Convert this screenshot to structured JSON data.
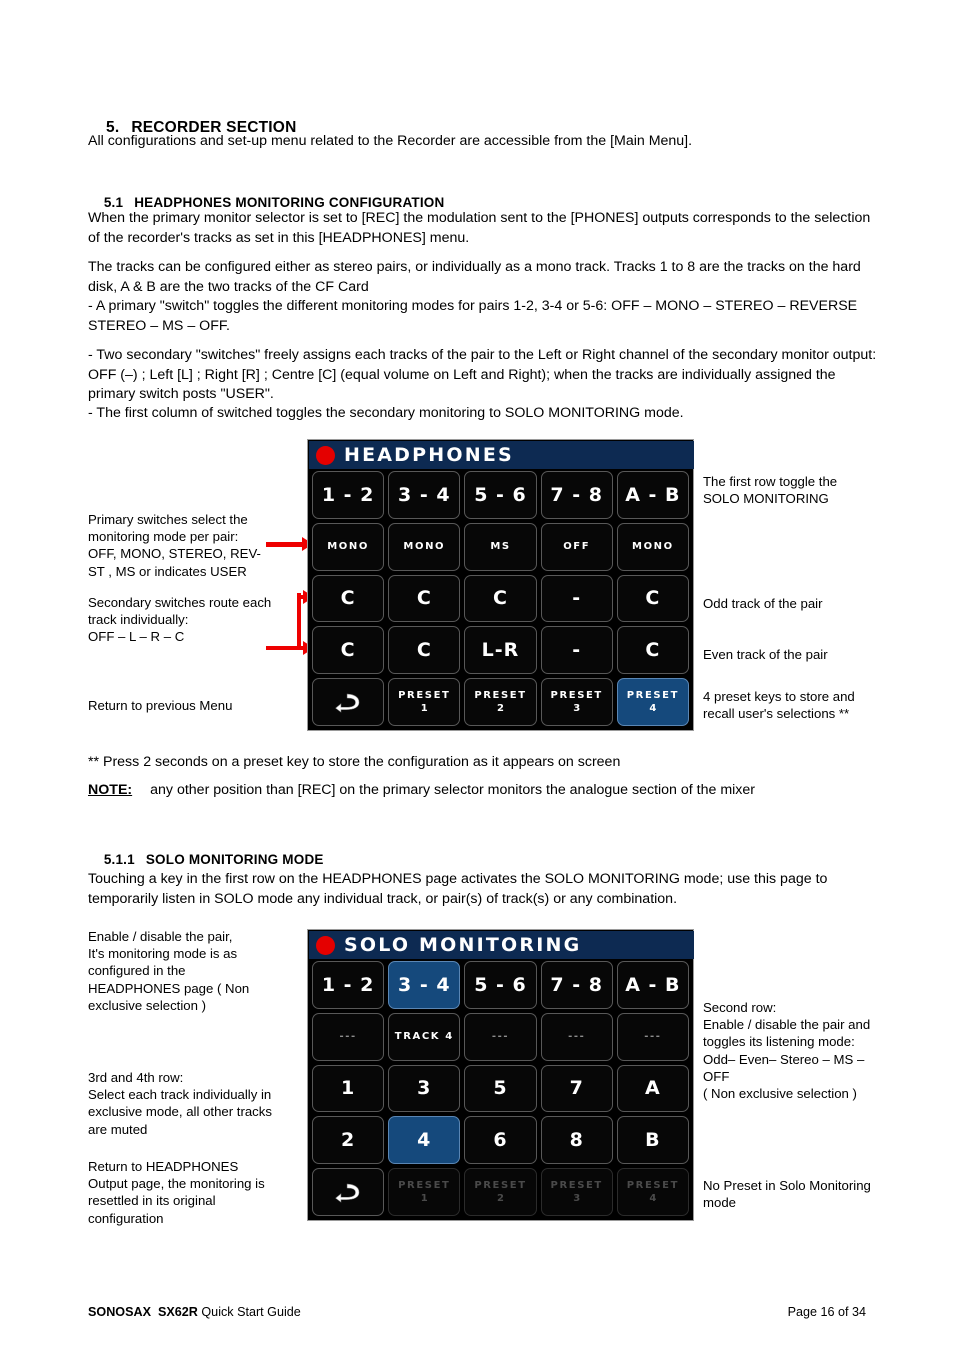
{
  "document": {
    "section_number": "5.",
    "section_title": "RECORDER SECTION",
    "intro": "All configurations and set-up menu related to the Recorder are accessible from the [Main Menu].",
    "sub1_number": "5.1",
    "sub1_title": "HEADPHONES MONITORING CONFIGURATION",
    "p1": "When the primary monitor selector is set to [REC] the modulation sent to the [PHONES] outputs corresponds to the selection of the recorder's tracks as set in this [HEADPHONES] menu.",
    "p2": "The tracks can be configured either as stereo pairs, or individually as a mono track. Tracks 1 to 8 are the tracks on the hard disk, A & B are the two tracks of the CF Card",
    "p3": "- A primary \"switch\" toggles the different monitoring modes for pairs 1-2, 3-4 or 5-6: OFF – MONO – STEREO – REVERSE STEREO – MS – OFF.",
    "p4": "- Two secondary \"switches\" freely assigns each tracks of the pair to the Left or Right channel of the secondary monitor output: OFF (–) ; Left [L] ; Right  [R] ; Centre [C] (equal volume on Left and Right); when the tracks are individually assigned the primary switch posts \"USER\".",
    "p5": "- The first column of switched toggles the secondary monitoring to SOLO MONITORING mode.",
    "p6": "** Press 2 seconds on a preset key to store the configuration as it appears on screen",
    "note_label": "NOTE:",
    "note_text": "any other position than [REC] on the primary selector monitors the analogue section of the mixer",
    "sub2_number": "5.1.1",
    "sub2_title": "SOLO MONITORING MODE",
    "p7": "Touching a key in the first row on the HEADPHONES page activates the SOLO MONITORING mode; use this page to temporarily listen in SOLO mode any individual track, or pair(s) of track(s) or any combination."
  },
  "headphones_screen": {
    "title": "HEADPHONES",
    "rec_indicator": "red-record-dot",
    "rows": [
      {
        "name": "pair-row",
        "keys": [
          {
            "label": "1 - 2",
            "style": "big",
            "state": "normal"
          },
          {
            "label": "3 - 4",
            "style": "big",
            "state": "normal"
          },
          {
            "label": "5 - 6",
            "style": "big",
            "state": "normal"
          },
          {
            "label": "7 - 8",
            "style": "big",
            "state": "normal"
          },
          {
            "label": "A - B",
            "style": "big",
            "state": "normal"
          }
        ]
      },
      {
        "name": "primary-switch-row",
        "keys": [
          {
            "label": "MONO",
            "style": "small",
            "state": "normal"
          },
          {
            "label": "MONO",
            "style": "small",
            "state": "normal"
          },
          {
            "label": "MS",
            "style": "small",
            "state": "normal"
          },
          {
            "label": "OFF",
            "style": "small",
            "state": "normal"
          },
          {
            "label": "MONO",
            "style": "small",
            "state": "normal"
          }
        ]
      },
      {
        "name": "odd-track-row",
        "keys": [
          {
            "label": "C",
            "style": "big",
            "state": "normal"
          },
          {
            "label": "C",
            "style": "big",
            "state": "normal"
          },
          {
            "label": "C",
            "style": "big",
            "state": "normal"
          },
          {
            "label": "-",
            "style": "big",
            "state": "normal"
          },
          {
            "label": "C",
            "style": "big",
            "state": "normal"
          }
        ]
      },
      {
        "name": "even-track-row",
        "keys": [
          {
            "label": "C",
            "style": "big",
            "state": "normal"
          },
          {
            "label": "C",
            "style": "big",
            "state": "normal"
          },
          {
            "label": "L-R",
            "style": "big",
            "state": "normal"
          },
          {
            "label": "-",
            "style": "big",
            "state": "normal"
          },
          {
            "label": "C",
            "style": "big",
            "state": "normal"
          }
        ]
      },
      {
        "name": "preset-row",
        "keys": [
          {
            "label": "",
            "style": "return",
            "state": "normal"
          },
          {
            "label": "PRESET",
            "sub": "1",
            "style": "preset",
            "state": "normal"
          },
          {
            "label": "PRESET",
            "sub": "2",
            "style": "preset",
            "state": "normal"
          },
          {
            "label": "PRESET",
            "sub": "3",
            "style": "preset",
            "state": "normal"
          },
          {
            "label": "PRESET",
            "sub": "4",
            "style": "preset",
            "state": "selected"
          }
        ]
      }
    ]
  },
  "solo_screen": {
    "title": "SOLO MONITORING",
    "rec_indicator": "red-record-dot",
    "rows": [
      {
        "name": "pair-row",
        "keys": [
          {
            "label": "1 - 2",
            "style": "big",
            "state": "normal"
          },
          {
            "label": "3 - 4",
            "style": "big",
            "state": "selected"
          },
          {
            "label": "5 - 6",
            "style": "big",
            "state": "normal"
          },
          {
            "label": "7 - 8",
            "style": "big",
            "state": "normal"
          },
          {
            "label": "A - B",
            "style": "big",
            "state": "normal"
          }
        ]
      },
      {
        "name": "mode-row",
        "keys": [
          {
            "label": "---",
            "style": "small",
            "state": "dimtext"
          },
          {
            "label": "TRACK 4",
            "style": "small",
            "state": "normal"
          },
          {
            "label": "---",
            "style": "small",
            "state": "dimtext"
          },
          {
            "label": "---",
            "style": "small",
            "state": "dimtext"
          },
          {
            "label": "---",
            "style": "small",
            "state": "dimtext"
          }
        ]
      },
      {
        "name": "odd-track-row",
        "keys": [
          {
            "label": "1",
            "style": "big",
            "state": "normal"
          },
          {
            "label": "3",
            "style": "big",
            "state": "normal"
          },
          {
            "label": "5",
            "style": "big",
            "state": "normal"
          },
          {
            "label": "7",
            "style": "big",
            "state": "normal"
          },
          {
            "label": "A",
            "style": "big",
            "state": "normal"
          }
        ]
      },
      {
        "name": "even-track-row",
        "keys": [
          {
            "label": "2",
            "style": "big",
            "state": "normal"
          },
          {
            "label": "4",
            "style": "big",
            "state": "selected"
          },
          {
            "label": "6",
            "style": "big",
            "state": "normal"
          },
          {
            "label": "8",
            "style": "big",
            "state": "normal"
          },
          {
            "label": "B",
            "style": "big",
            "state": "normal"
          }
        ]
      },
      {
        "name": "preset-row",
        "keys": [
          {
            "label": "",
            "style": "return",
            "state": "normal"
          },
          {
            "label": "PRESET",
            "sub": "1",
            "style": "preset",
            "state": "disabled"
          },
          {
            "label": "PRESET",
            "sub": "2",
            "style": "preset",
            "state": "disabled"
          },
          {
            "label": "PRESET",
            "sub": "3",
            "style": "preset",
            "state": "disabled"
          },
          {
            "label": "PRESET",
            "sub": "4",
            "style": "preset",
            "state": "disabled"
          }
        ]
      }
    ]
  },
  "annotations": {
    "hp_left_primary": "Primary switches select the\nmonitoring mode per pair:\nOFF, MONO, STEREO, REV-\nST , MS or indicates USER",
    "hp_left_secondary": "Secondary switches route each\ntrack individually:\nOFF – L – R – C",
    "hp_left_return": "Return to previous Menu",
    "hp_right_first_row": "The first row toggle the\nSOLO MONITORING",
    "hp_right_odd": "Odd track of the pair",
    "hp_right_even": "Even track of the pair",
    "hp_right_preset": "4 preset keys to store and\nrecall user's selections **",
    "solo_left_enable": "Enable / disable the pair,\nIt's monitoring mode is as\nconfigured in the\nHEADPHONES page ( Non\nexclusive selection )",
    "solo_left_rows34": "3rd and 4th row:\nSelect each track individually in\nexclusive mode, all other tracks\nare muted",
    "solo_left_return": "Return to HEADPHONES\nOutput page, the monitoring is\nresettled in its original\nconfiguration",
    "solo_right_second_row": "Second row:\nEnable / disable the pair  and\ntoggles its listening mode:\nOdd– Even– Stereo – MS –\nOFF\n( Non exclusive selection )",
    "solo_right_preset": "No Preset in Solo Monitoring\nmode"
  },
  "footer": {
    "brand": "SONOSAX",
    "model": "SX62R",
    "doc": "Quick Start Guide",
    "page": "Page 16 of 34"
  },
  "colors": {
    "screen_header_blue": "#0d2a52",
    "selected_key_blue": "#15497c",
    "record_red": "#e40000",
    "arrow_red": "#ee0000"
  }
}
